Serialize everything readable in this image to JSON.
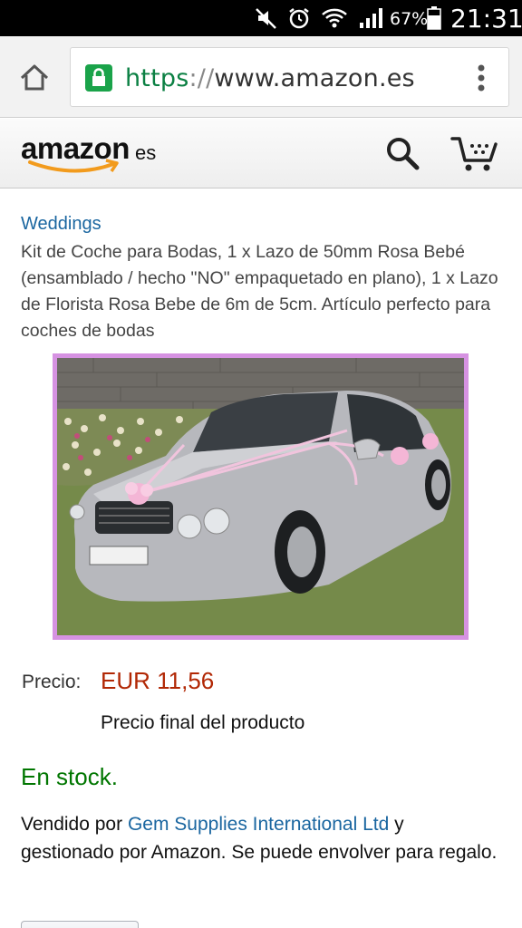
{
  "status_bar": {
    "battery_percent": "67%",
    "clock": "21:31",
    "icons": [
      "mute-icon",
      "alarm-icon",
      "wifi-icon",
      "signal-icon",
      "battery-icon"
    ]
  },
  "browser": {
    "url_scheme": "https",
    "url_sep": "://",
    "url_host": "www.amazon.es",
    "icons": [
      "home-icon",
      "lock-icon",
      "overflow-menu-icon"
    ]
  },
  "header": {
    "logo_word": "amazon",
    "logo_suffix": "es",
    "icons": [
      "search-icon",
      "cart-icon"
    ]
  },
  "product": {
    "brand": "Weddings",
    "title": "Kit de Coche para Bodas, 1 x Lazo de 50mm Rosa Bebé (ensamblado / hecho \"NO\" empaquetado en plano), 1 x Lazo de Florista Rosa Bebe de 6m de 5cm. Artículo perfecto para coches de bodas",
    "price_label": "Precio:",
    "price_value": "EUR 11,56",
    "price_note": "Precio final del producto",
    "stock": "En stock.",
    "seller_prefix": "Vendido por ",
    "seller_name": "Gem Supplies International Ltd",
    "seller_suffix": " y gestionado por Amazon. Se puede envolver para regalo."
  },
  "colors": {
    "link": "#1a66a0",
    "price": "#b12704",
    "in_stock": "#007600",
    "https_green": "#0b8043",
    "image_frame": "#d692e2",
    "logo_smile": "#f29b1d"
  }
}
